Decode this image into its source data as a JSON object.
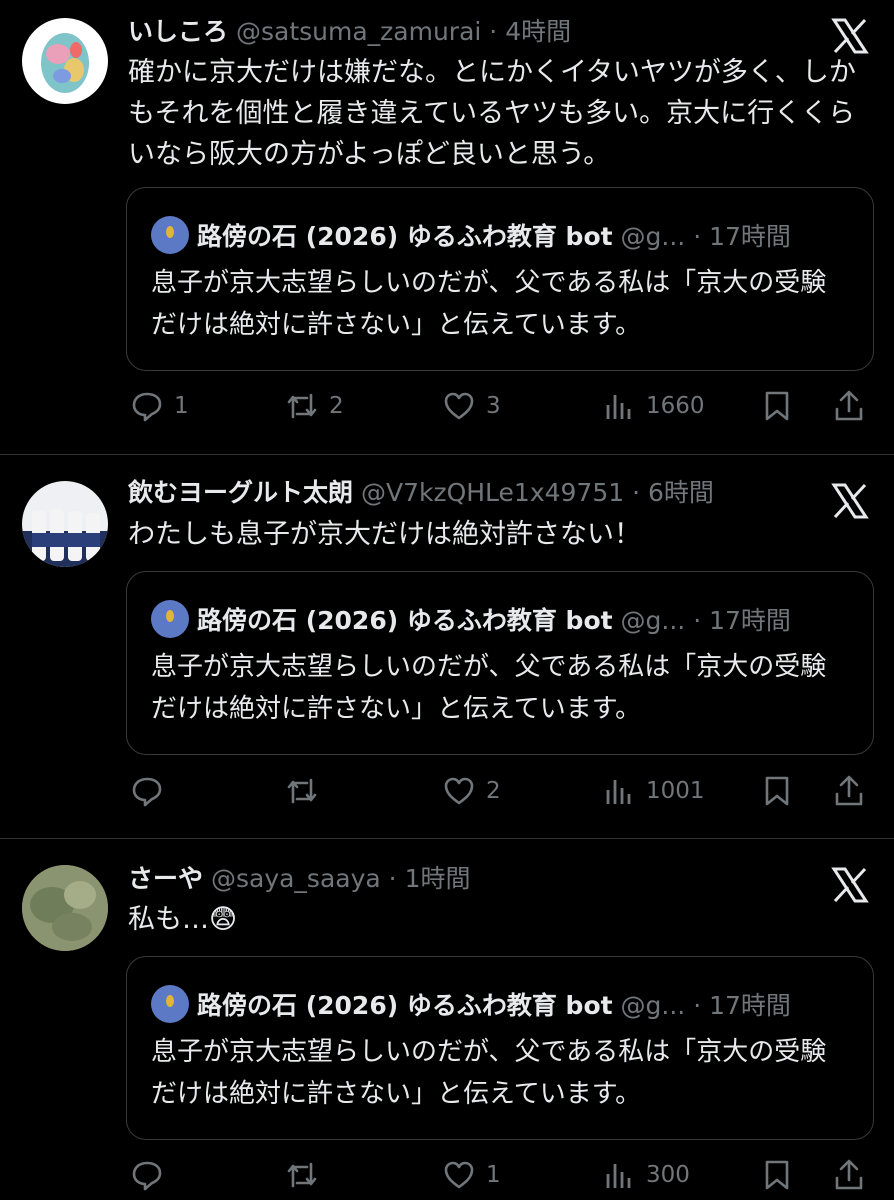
{
  "posts": [
    {
      "name": "いしころ",
      "handle": "@satsuma_zamurai",
      "dot": "·",
      "time": "4時間",
      "text": "確かに京大だけは嫌だな。とにかくイタいヤツが多く、しかもそれを個性と履き違えているヤツも多い。京大に行くくらいなら阪大の方がよっぽど良いと思う。",
      "quote": {
        "name": "路傍の石 (2026) ゆるふわ教育 bot",
        "handle": "@g...",
        "dot": "·",
        "time": "17時間",
        "text": "息子が京大志望らしいのだが、父である私は「京大の受験だけは絶対に許さない」と伝えています。"
      },
      "replies": "1",
      "reposts": "2",
      "likes": "3",
      "views": "1660"
    },
    {
      "name": "飲むヨーグルト太朗",
      "handle": "@V7kzQHLe1x49751",
      "dot": "·",
      "time": "6時間",
      "text": "わたしも息子が京大だけは絶対許さない！",
      "quote": {
        "name": "路傍の石 (2026) ゆるふわ教育 bot",
        "handle": "@g...",
        "dot": "·",
        "time": "17時間",
        "text": "息子が京大志望らしいのだが、父である私は「京大の受験だけは絶対に許さない」と伝えています。"
      },
      "replies": "",
      "reposts": "",
      "likes": "2",
      "views": "1001"
    },
    {
      "name": "さーや",
      "handle": "@saya_saaya",
      "dot": "·",
      "time": "1時間",
      "text": "私も…😨",
      "quote": {
        "name": "路傍の石 (2026) ゆるふわ教育 bot",
        "handle": "@g...",
        "dot": "·",
        "time": "17時間",
        "text": "息子が京大志望らしいのだが、父である私は「京大の受験だけは絶対に許さない」と伝えています。"
      },
      "replies": "",
      "reposts": "",
      "likes": "1",
      "views": "300"
    }
  ],
  "colors": {
    "background": "#000000",
    "text": "#e7e9ea",
    "muted": "#71767b",
    "border": "#2f3336"
  },
  "icons": [
    "x-logo-icon",
    "reply-icon",
    "repost-icon",
    "like-icon",
    "views-icon",
    "bookmark-icon",
    "share-icon"
  ]
}
